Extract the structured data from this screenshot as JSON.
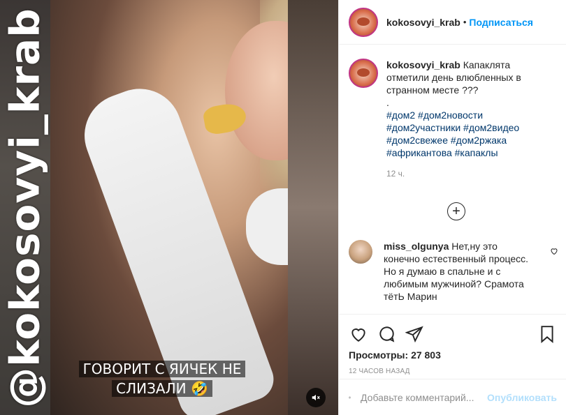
{
  "media": {
    "watermark": "@kokosovyi_krab",
    "caption_line1": "ГОВОРИТ С ЯИЧЕК НЕ",
    "caption_line2": "СЛИЗАЛИ 🤣",
    "mute_icon": "speaker-muted-icon"
  },
  "header": {
    "username": "kokosovyi_krab",
    "dot": "•",
    "follow_label": "Подписаться"
  },
  "post": {
    "username": "kokosovyi_krab",
    "caption": "Капаклята отметили день влюбленных в странном месте",
    "caption_emoji": "???",
    "separator": ".",
    "hashtags": [
      "#дом2 #дом2новости",
      "#дом2участники #дом2видео",
      "#дом2свежее #дом2ржака",
      "#африкантова #капаклы"
    ],
    "time": "12 ч."
  },
  "comment": {
    "username": "miss_olgunya",
    "text": "Нет,ну это конечно естественный процесс. Но я думаю в спальне и с любимым мужчиной? Срамота тётЬ Марин"
  },
  "stats": {
    "views_label": "Просмотры:",
    "views_value": "27 803",
    "ago": "12 ЧАСОВ НАЗАД"
  },
  "add_comment": {
    "placeholder": "Добавьте комментарий...",
    "publish_label": "Опубликовать"
  },
  "colors": {
    "accent": "#0095f6",
    "hashtag": "#00376b",
    "muted": "#8e8e8e",
    "publish_disabled": "#b2dffc"
  }
}
